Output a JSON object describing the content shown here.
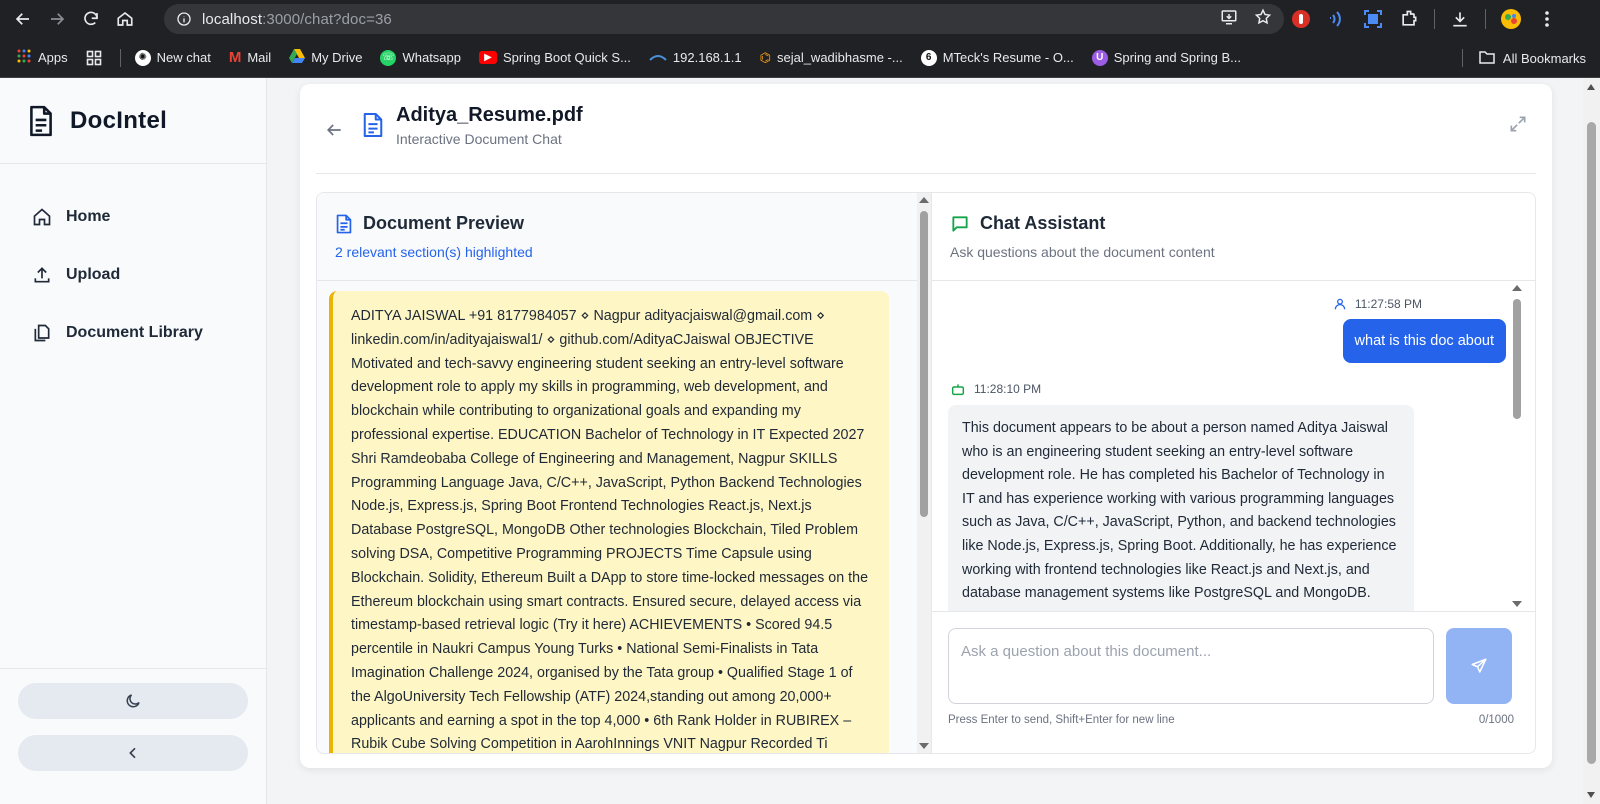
{
  "browser": {
    "url_host": "localhost",
    "url_rest": ":3000/chat?doc=36",
    "bookmarks": [
      {
        "label": "Apps",
        "icon": "apps-grid-icon",
        "color": "#ea4335"
      },
      {
        "label": "New chat",
        "icon": "openai-icon",
        "color": "#ffffff"
      },
      {
        "label": "Mail",
        "icon": "gmail-icon",
        "color": "#ea4335"
      },
      {
        "label": "My Drive",
        "icon": "drive-icon",
        "color": "#34a853"
      },
      {
        "label": "Whatsapp",
        "icon": "whatsapp-icon",
        "color": "#25d366"
      },
      {
        "label": "Spring Boot Quick S...",
        "icon": "youtube-icon",
        "color": "#ff0000"
      },
      {
        "label": "192.168.1.1",
        "icon": "router-icon",
        "color": "#4a90d9"
      },
      {
        "label": "sejal_wadibhasme -...",
        "icon": "leetcode-icon",
        "color": "#ffa116"
      },
      {
        "label": "MTeck's Resume - O...",
        "icon": "overleaf-icon",
        "color": "#ffffff"
      },
      {
        "label": "Spring and Spring B...",
        "icon": "bookmark-purple-icon",
        "color": "#9b5de5"
      }
    ],
    "all_bookmarks": "All Bookmarks"
  },
  "sidebar": {
    "brand": "DocIntel",
    "items": [
      {
        "label": "Home",
        "icon": "home-icon"
      },
      {
        "label": "Upload",
        "icon": "upload-icon"
      },
      {
        "label": "Document Library",
        "icon": "library-icon"
      }
    ]
  },
  "header": {
    "title": "Aditya_Resume.pdf",
    "subtitle": "Interactive Document Chat"
  },
  "preview": {
    "title": "Document Preview",
    "subtitle": "2 relevant section(s) highlighted",
    "text": "ADITYA JAISWAL +91 8177984057 ⋄ Nagpur adityacjaiswal@gmail.com ⋄ linkedin.com/in/adityajaiswal1/ ⋄ github.com/AdityaCJaiswal OBJECTIVE Motivated and tech-savvy engineering student seeking an entry-level software development role to apply my skills in programming, web development, and blockchain while contributing to organizational goals and expanding my professional expertise. EDUCATION Bachelor of Technology in IT Expected 2027 Shri Ramdeobaba College of Engineering and Management, Nagpur SKILLS Programming Language Java, C/C++, JavaScript, Python Backend Technologies Node.js, Express.js, Spring Boot Frontend Technologies React.js, Next.js Database PostgreSQL, MongoDB Other technologies Blockchain, Tiled Problem solving DSA, Competitive Programming PROJECTS Time Capsule using Blockchain. Solidity, Ethereum Built a DApp to store time-locked messages on the Ethereum blockchain using smart contracts. Ensured secure, delayed access via timestamp-based retrieval logic (Try it here) ACHIEVEMENTS • Scored 94.5 percentile in Naukri Campus Young Turks • National Semi-Finalists in Tata Imagination Challenge 2024, organised by the Tata group • Qualified Stage 1 of the AlgoUniversity Tech Fellowship (ATF) 2024,standing out among 20,000+ applicants and earning a spot in the top 4,000 • 6th Rank Holder in RUBIREX – Rubik Cube Solving Competition in AarohInnings VNIT Nagpur Recorded Ti"
  },
  "chat": {
    "title": "Chat Assistant",
    "subtitle": "Ask questions about the document content",
    "messages": [
      {
        "role": "user",
        "time": "11:27:58 PM",
        "text": "what is this doc about"
      },
      {
        "role": "assistant",
        "time": "11:28:10 PM",
        "text": "This document appears to be about a person named Aditya Jaiswal who is an engineering student seeking an entry-level software development role. He has completed his Bachelor of Technology in IT and has experience working with various programming languages such as Java, C/C++, JavaScript, Python, and backend technologies like Node.js, Express.js, Spring Boot. Additionally, he has experience working with frontend technologies like React.js and Next.js, and database management systems like PostgreSQL and MongoDB."
      }
    ],
    "input_placeholder": "Ask a question about this document...",
    "input_value": "",
    "hint": "Press Enter to send, Shift+Enter for new line",
    "counter": "0/1000"
  },
  "colors": {
    "accent": "#2563eb",
    "highlight_bg": "#fef6c4",
    "highlight_border": "#eab308",
    "chat_icon": "#16a34a",
    "send_disabled": "#93b4f4"
  }
}
